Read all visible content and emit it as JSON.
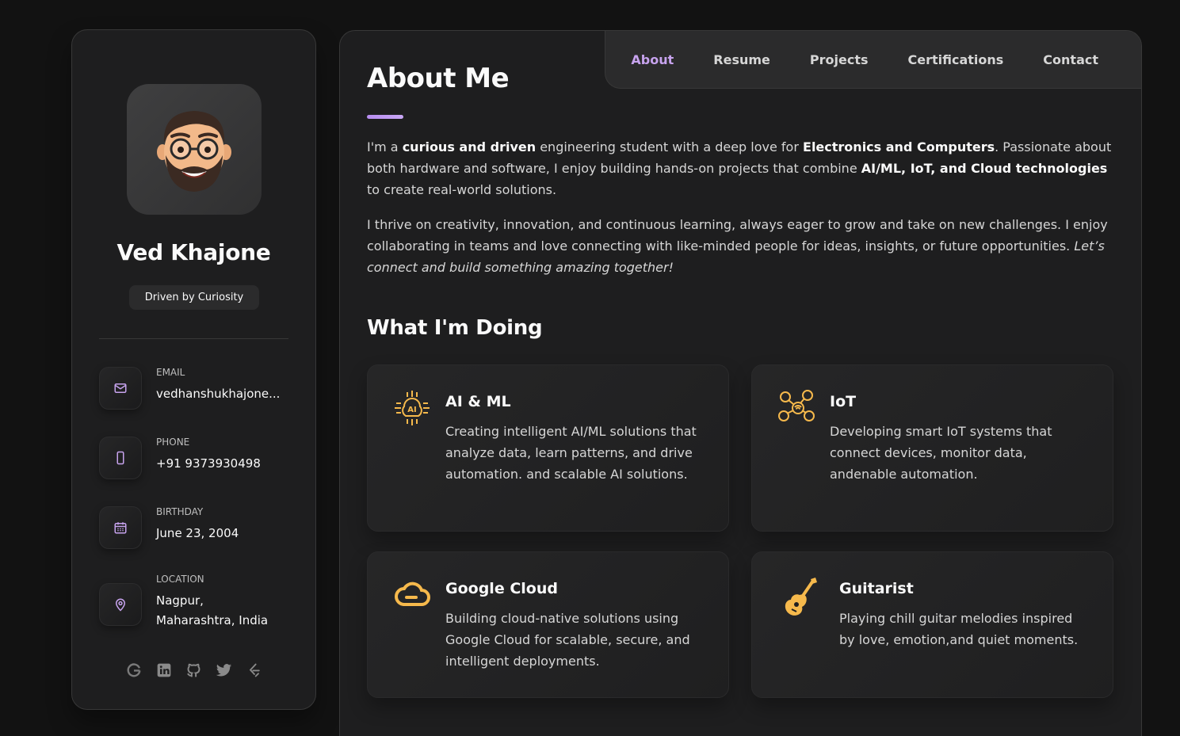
{
  "profile": {
    "name": "Ved Khajone",
    "tagline": "Driven by Curiosity",
    "contacts": [
      {
        "label": "EMAIL",
        "value": "vedhanshukhajone...",
        "icon": "mail-icon"
      },
      {
        "label": "PHONE",
        "value": "+91 9373930498",
        "icon": "phone-icon"
      },
      {
        "label": "BIRTHDAY",
        "value": "June 23, 2004",
        "icon": "calendar-icon"
      },
      {
        "label": "LOCATION",
        "value": "Nagpur, Maharashtra, India",
        "icon": "location-pin-icon"
      }
    ],
    "socials": [
      "google-icon",
      "linkedin-icon",
      "github-icon",
      "twitter-icon",
      "leetcode-icon"
    ]
  },
  "nav": {
    "items": [
      "About",
      "Resume",
      "Projects",
      "Certifications",
      "Contact"
    ],
    "active": "About"
  },
  "about": {
    "title": "About Me",
    "p1": {
      "t1": "I'm a ",
      "b1": "curious and driven",
      "t2": " engineering student with a deep love for ",
      "b2": "Electronics and Computers",
      "t3": ". Passionate about both hardware and software, I enjoy building hands-on projects that combine ",
      "b3": "AI/ML, IoT, and Cloud technologies",
      "t4": " to create real-world solutions."
    },
    "p2": {
      "t1": "I thrive on creativity, innovation, and continuous learning, always eager to grow and take on new challenges. I enjoy collaborating in teams and love connecting with like-minded people for ideas, insights, or future opportunities. ",
      "i1": "Let’s connect and build something amazing together!"
    }
  },
  "doing": {
    "title": "What I'm Doing",
    "services": [
      {
        "title": "AI & ML",
        "text": "Creating intelligent AI/ML solutions that analyze data, learn patterns, and drive automation. and scalable AI solutions.",
        "icon": "ai-chip-icon"
      },
      {
        "title": "IoT",
        "text": "Developing smart IoT systems that connect devices, monitor data, andenable automation.",
        "icon": "iot-network-icon"
      },
      {
        "title": "Google Cloud",
        "text": "Building cloud-native solutions using Google Cloud for scalable, secure, and intelligent deployments.",
        "icon": "cloud-icon"
      },
      {
        "title": "Guitarist",
        "text": "Playing chill guitar melodies inspired by love, emotion,and quiet moments.",
        "icon": "guitar-icon"
      }
    ]
  },
  "colors": {
    "accent": "#c7a3ee",
    "icon_gold": "#f6b94c",
    "card_bg": "#1e1e1f",
    "page_bg": "#121212"
  }
}
